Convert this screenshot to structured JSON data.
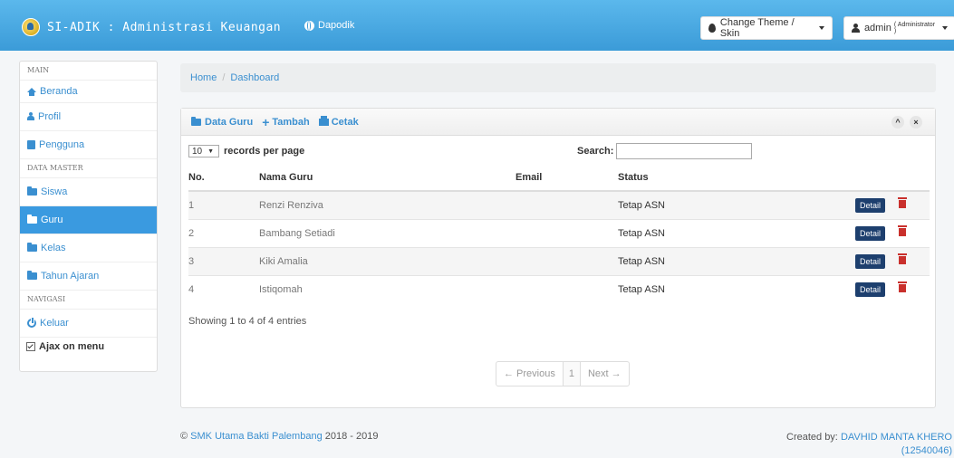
{
  "header": {
    "app_title": "SI-ADIK : Administrasi Keuangan",
    "dapodik_link": "Dapodik",
    "theme_button": "Change Theme / Skin",
    "user_name": "admin",
    "user_role": "( Administrator )"
  },
  "sidebar": {
    "section_main": "MAIN",
    "item_beranda": "Beranda",
    "item_profil": "Profil",
    "item_pengguna": "Pengguna",
    "section_data_master": "DATA MASTER",
    "item_siswa": "Siswa",
    "item_guru": "Guru",
    "item_kelas": "Kelas",
    "item_tahun_ajaran": "Tahun Ajaran",
    "section_navigasi": "NAVIGASI",
    "item_keluar": "Keluar",
    "ajax_label": "Ajax on menu",
    "active_item": "Guru"
  },
  "breadcrumb": {
    "home": "Home",
    "separator": "/",
    "current": "Dashboard"
  },
  "panel": {
    "title": "Data Guru",
    "add_label": "Tambah",
    "print_label": "Cetak",
    "collapse_glyph": "^",
    "close_glyph": "×",
    "records_value": "10",
    "records_label": "records per page",
    "search_label": "Search:",
    "columns": {
      "no": "No.",
      "nama": "Nama Guru",
      "email": "Email",
      "status": "Status"
    },
    "rows": [
      {
        "no": "1",
        "nama": "Renzi Renziva",
        "email": "",
        "status": "Tetap ASN",
        "action": "Detail"
      },
      {
        "no": "2",
        "nama": "Bambang Setiadi",
        "email": "",
        "status": "Tetap ASN",
        "action": "Detail"
      },
      {
        "no": "3",
        "nama": "Kiki Amalia",
        "email": "",
        "status": "Tetap ASN",
        "action": "Detail"
      },
      {
        "no": "4",
        "nama": "Istiqomah",
        "email": "",
        "status": "Tetap ASN",
        "action": "Detail"
      }
    ],
    "info": "Showing 1 to 4 of 4 entries",
    "pager": {
      "previous": "← Previous",
      "current": "1",
      "next": "Next →"
    }
  },
  "footer": {
    "left_link": "SMK Utama Bakti Palembang",
    "left_copy": "©",
    "left_year": "2018 - 2019",
    "right_prefix": "Created by:",
    "right_link": "DAVHID MANTA KHERO",
    "right_id": "(12540046)"
  }
}
